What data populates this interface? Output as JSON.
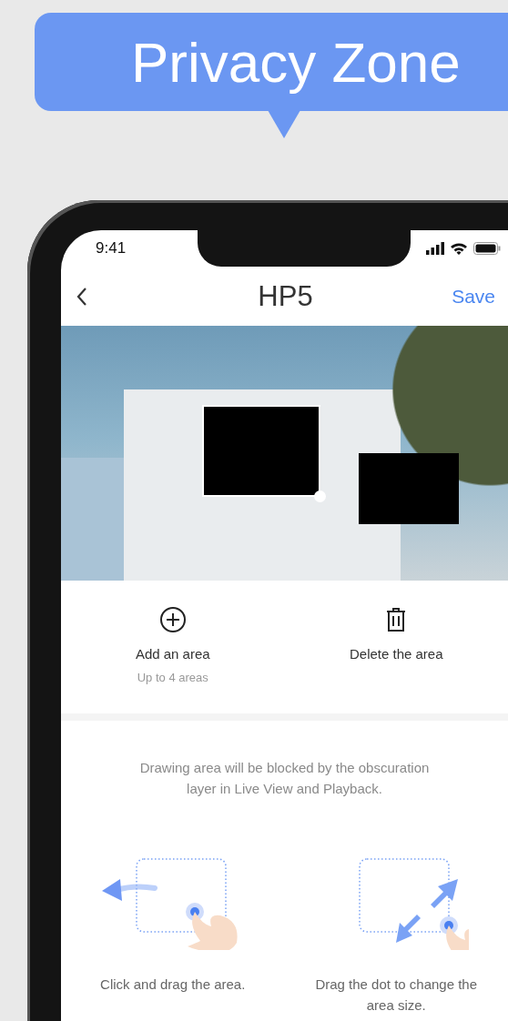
{
  "banner": {
    "title": "Privacy Zone"
  },
  "status_bar": {
    "time": "9:41"
  },
  "nav": {
    "title": "HP5",
    "action": "Save"
  },
  "camera_view": {
    "areas": [
      {
        "selected": true
      },
      {
        "selected": false
      }
    ]
  },
  "actions": [
    {
      "kind": "add",
      "label": "Add an area",
      "hint": "Up to 4 areas"
    },
    {
      "kind": "delete",
      "label": "Delete the area"
    }
  ],
  "instructions": {
    "text": "Drawing area will be blocked by the obscuration layer in Live View and Playback.",
    "steps": [
      {
        "kind": "move",
        "caption": "Click and drag the area."
      },
      {
        "kind": "resize",
        "caption": "Drag the dot to change the area size."
      }
    ]
  }
}
